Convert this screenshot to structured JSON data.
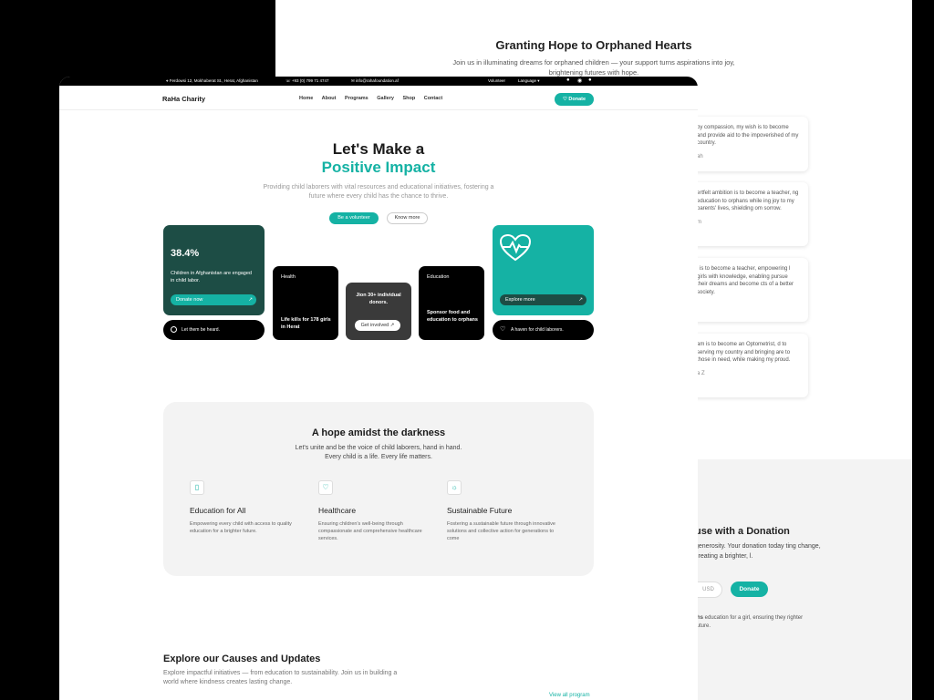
{
  "back_page": {
    "title": "Granting Hope to Orphaned Hearts",
    "subtitle": "Join us in illuminating dreams for orphaned children — your support turns aspirations into joy, brightening futures with hope.",
    "testimonials": [
      {
        "text": "by compassion, my wish is to become and provide aid to the impoverished of my country.",
        "who": "ah"
      },
      {
        "text": "ertfelt ambition is to become a teacher, ng education to orphans while ing joy to my parents' lives, shielding om sorrow.",
        "who": "m"
      },
      {
        "text": "l is to become a teacher, empowering l girls with knowledge, enabling pursue their dreams and become cts of a better society.",
        "who": "i"
      },
      {
        "text": "am is to become an Optometrist, d to serving my country and bringing are to those in need, while making my proud.",
        "who": "a Z"
      }
    ],
    "donation": {
      "title": "use with a Donation",
      "text": "generosity. Your donation today ting change, creating a brighter, l.",
      "currency": "USD",
      "button": "Donate",
      "note_bold": "ths",
      "note": "education for a girl, ensuring they righter future."
    }
  },
  "topbar": {
    "address": "Ferdowsi 12, Mokhaberat St., Herat, Afghanistan",
    "phone": "+93 (0) 799 71 4747",
    "email": "info@rahafoundation.af",
    "volunteer": "Volunteer",
    "language": "Language"
  },
  "nav": {
    "logo": "RaHa Charity",
    "items": [
      "Home",
      "About",
      "Programs",
      "Gallery",
      "Shop",
      "Contact"
    ],
    "donate": "Donate"
  },
  "hero": {
    "line1": "Let's Make a",
    "line2": "Positive Impact",
    "subtitle": "Providing child laborers with vital resources and educational initiatives, fostering a future where every child has the chance to thrive.",
    "btn_primary": "Be a volunteer",
    "btn_secondary": "Know more"
  },
  "cards": {
    "stat": {
      "value": "38.4%",
      "text": "Children in Afghanistan are engaged in child labor.",
      "button": "Donate now"
    },
    "heard": "Let them be heard.",
    "health": {
      "label": "Health",
      "text": "Life kills for 178 girls in Herat"
    },
    "join": {
      "text": "Jion 30+ individual donors.",
      "button": "Get involved"
    },
    "education": {
      "label": "Education",
      "text": "Sponsor food and education to orphans"
    },
    "explore": "Explore more",
    "haven": "A haven for child laborers."
  },
  "hope": {
    "title": "A hope amidst the darkness",
    "subtitle1": "Let's unite and be the voice of child laborers, hand in hand.",
    "subtitle2": "Every child is a life. Every life matters.",
    "features": [
      {
        "icon": "book-icon",
        "title": "Education for All",
        "desc": "Empowering every child with access to quality education for a brighter future."
      },
      {
        "icon": "heart-icon",
        "title": "Healthcare",
        "desc": "Ensuring children's well-being through compassionate and comprehensive healthcare services."
      },
      {
        "icon": "sun-icon",
        "title": "Sustainable Future",
        "desc": "Fostering a sustainable future through innovative solutions and collective action for generations to come"
      }
    ]
  },
  "explore": {
    "title": "Explore our Causes and Updates",
    "subtitle": "Explore impactful initiatives — from education to sustainability. Join us in building a world where kindness creates lasting change.",
    "view_all": "View all program"
  },
  "colors": {
    "accent": "#15b2a4",
    "dark_green": "#1d4d45"
  }
}
